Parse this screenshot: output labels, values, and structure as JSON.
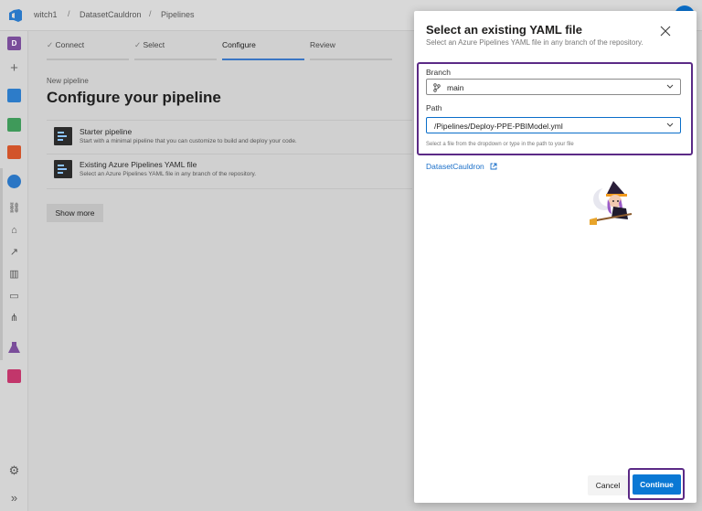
{
  "breadcrumb": {
    "org": "witch1",
    "project": "DatasetCauldron",
    "section": "Pipelines",
    "separator": "/"
  },
  "rail": {
    "user_initial": "D",
    "items": [
      "plus-icon",
      "boards-icon",
      "repos-icon",
      "pipelines-icon",
      "overview-icon",
      "pipelines-sub-icon",
      "environments-icon",
      "releases-icon",
      "library-icon",
      "task-groups-icon",
      "deployment-groups-icon",
      "test-plans-icon",
      "artifacts-icon"
    ],
    "settings_icon": "gear-icon",
    "expand_icon": "double-chevron-right-icon"
  },
  "wizard": {
    "steps": [
      {
        "label": "Connect",
        "done": true
      },
      {
        "label": "Select",
        "done": true
      },
      {
        "label": "Configure",
        "done": false,
        "active": true
      },
      {
        "label": "Review",
        "done": false
      }
    ],
    "check": "✓",
    "new_pipeline": "New pipeline",
    "title": "Configure your pipeline",
    "options": [
      {
        "title": "Starter pipeline",
        "desc": "Start with a minimal pipeline that you can customize to build and deploy your code."
      },
      {
        "title": "Existing Azure Pipelines YAML file",
        "desc": "Select an Azure Pipelines YAML file in any branch of the repository."
      }
    ],
    "show_more": "Show more"
  },
  "panel": {
    "title": "Select an existing YAML file",
    "subtitle": "Select an Azure Pipelines YAML file in any branch of the repository.",
    "branch_label": "Branch",
    "branch_value": "main",
    "path_label": "Path",
    "path_value": "/Pipelines/Deploy-PPE-PBIModel.yml",
    "hint": "Select a file from the dropdown or type in the path to your file",
    "repo_link": "DatasetCauldron",
    "cancel": "Cancel",
    "continue": "Continue"
  },
  "colors": {
    "accent": "#0a78d4",
    "highlight": "#5b2a86",
    "link": "#1a6fc9"
  }
}
